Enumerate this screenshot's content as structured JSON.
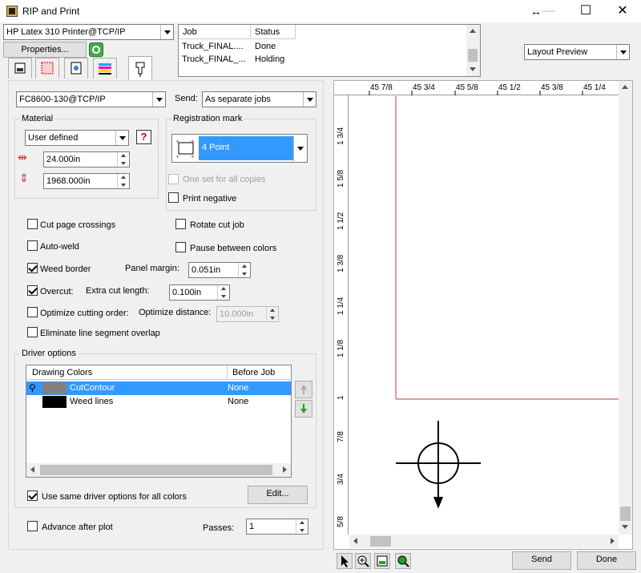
{
  "window": {
    "title": "RIP and Print"
  },
  "printer": {
    "selected": "HP Latex 310 Printer@TCP/IP",
    "properties_label": "Properties..."
  },
  "jobs": {
    "columns": [
      "Job",
      "Status"
    ],
    "rows": [
      {
        "job": "Truck_FINAL....",
        "status": "Done"
      },
      {
        "job": "Truck_FINAL_...",
        "status": "Holding"
      }
    ]
  },
  "preview": {
    "mode": "Layout Preview"
  },
  "cutter": {
    "device": "FC8600-130@TCP/IP",
    "send_label": "Send:",
    "send_mode": "As separate jobs"
  },
  "material": {
    "group_label": "Material",
    "type": "User defined",
    "width": "24.000in",
    "length": "1968.000in"
  },
  "registration": {
    "group_label": "Registration mark",
    "mark": "4 Point",
    "one_set_label": "One set for all copies",
    "print_negative_label": "Print negative"
  },
  "options": {
    "cut_page_crossings": "Cut page crossings",
    "rotate_cut_job": "Rotate cut job",
    "auto_weld": "Auto-weld",
    "pause_between_colors": "Pause between colors",
    "weed_border": "Weed border",
    "panel_margin_label": "Panel margin:",
    "panel_margin": "0.051in",
    "overcut": "Overcut:",
    "extra_cut_label": "Extra cut length:",
    "extra_cut": "0.100in",
    "optimize_order": "Optimize cutting order:",
    "optimize_distance_label": "Optimize distance:",
    "optimize_distance": "10.000in",
    "eliminate_overlap": "Eliminate line segment overlap"
  },
  "driver": {
    "group_label": "Driver options",
    "columns": [
      "Drawing Colors",
      "Before Job"
    ],
    "rows": [
      {
        "name": "CutContour",
        "value": "None",
        "swatch": "#808080"
      },
      {
        "name": "Weed lines",
        "value": "None",
        "swatch": "#000000"
      }
    ],
    "same_options_label": "Use same driver options for all colors",
    "edit_label": "Edit..."
  },
  "footer": {
    "advance_label": "Advance after plot",
    "passes_label": "Passes:",
    "passes": "1",
    "send_label": "Send",
    "done_label": "Done"
  },
  "ruler": {
    "h_ticks": [
      "45 7/8",
      "45 3/4",
      "45 5/8",
      "45 1/2",
      "45 3/8",
      "45 1/4"
    ],
    "v_ticks": [
      "1 3/4",
      "1 5/8",
      "1 1/2",
      "1 3/8",
      "1 1/4",
      "1 1/8",
      "1",
      "7/8",
      "3/4",
      "5/8"
    ]
  },
  "colors": {
    "selection": "#3399ff",
    "accent_red": "#cc3333",
    "title_icon": "#e8b23a"
  }
}
